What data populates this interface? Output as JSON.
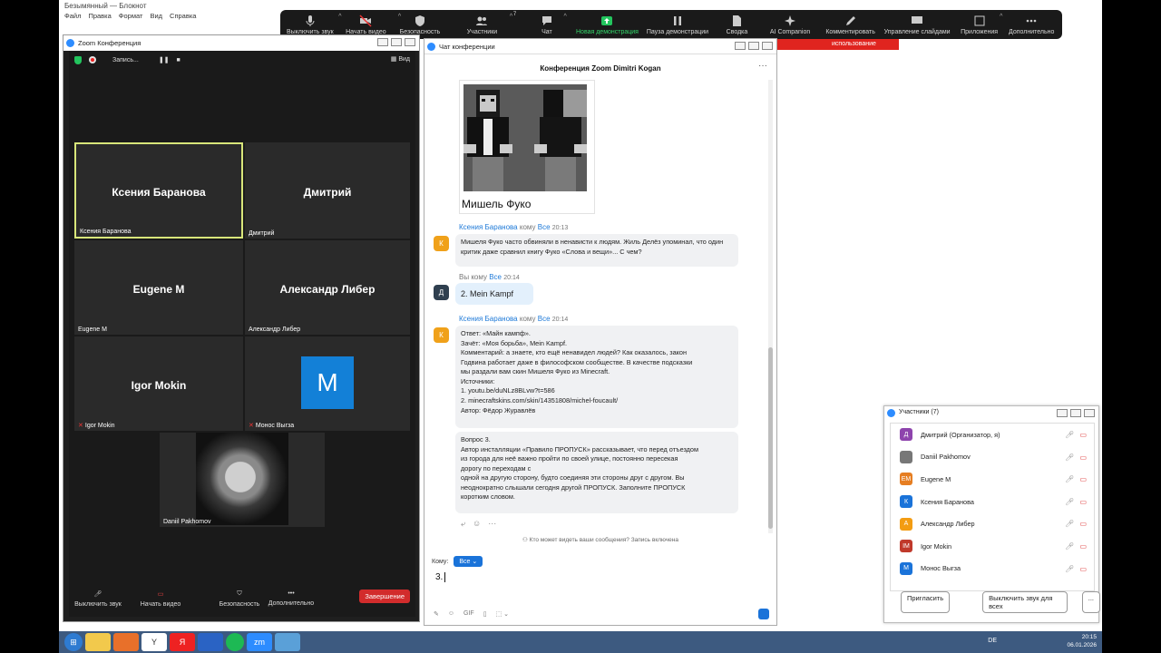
{
  "notepad": {
    "title": "Безымянный — Блокнот",
    "menu": [
      "Файл",
      "Правка",
      "Формат",
      "Вид",
      "Справка"
    ],
    "stop_banner": "использование"
  },
  "toolbar": [
    {
      "label": "Выключить звук",
      "icon": "mic-icon"
    },
    {
      "label": "Начать видео",
      "icon": "video-off-icon"
    },
    {
      "label": "Безопасность",
      "icon": "shield-icon"
    },
    {
      "label": "Участники",
      "icon": "participants-icon",
      "badge": "7"
    },
    {
      "label": "Чат",
      "icon": "chat-icon"
    },
    {
      "label": "Новая демонстрация",
      "icon": "share-icon"
    },
    {
      "label": "Пауза демонстрации",
      "icon": "pause-icon"
    },
    {
      "label": "Сводка",
      "icon": "summary-icon"
    },
    {
      "label": "AI Companion",
      "icon": "sparkle-icon"
    },
    {
      "label": "Комментировать",
      "icon": "pen-icon"
    },
    {
      "label": "Управление слайдами",
      "icon": "slides-icon"
    },
    {
      "label": "Приложения",
      "icon": "apps-icon"
    },
    {
      "label": "Дополнительно",
      "icon": "more-icon"
    }
  ],
  "meeting": {
    "title": "Zoom Конференция",
    "recording": "Запись...",
    "view": "Вид",
    "tiles": [
      {
        "big": "Ксения Баранова",
        "small": "Ксения Баранова"
      },
      {
        "big": "Дмитрий",
        "small": "Дмитрий"
      },
      {
        "big": "Eugene M",
        "small": "Eugene M"
      },
      {
        "big": "Александр Либер",
        "small": "Александр Либер"
      },
      {
        "big": "Igor Mokin",
        "small": "Igor Mokin"
      },
      {
        "big": "M",
        "small": "Монос Выгза"
      },
      {
        "big": "",
        "small": "Daniil Pakhomov"
      }
    ],
    "bottom": {
      "mute": "Выключить звук",
      "video": "Начать видео",
      "security": "Безопасность",
      "more": "Дополнительно",
      "end": "Завершение"
    }
  },
  "chat": {
    "window_title": "Чат конференции",
    "header": "Конференция Zoom Dimitri Kogan",
    "image_caption": "Мишель Фуко",
    "messages": [
      {
        "sender": "Ксения Баранова",
        "to_word": "кому",
        "to": "Все",
        "time": "20:13",
        "avatar": "К",
        "text": "Мишеля Фуко часто обвиняли в ненависти к людям. Жиль Делёз упоминал, что один критик даже сравнил книгу Фуко «Слова и вещи»... С чем?"
      },
      {
        "sender": "Вы",
        "to_word": "кому",
        "to": "Все",
        "time": "20:14",
        "avatar": "Д",
        "text": "2. Mein Kampf"
      },
      {
        "sender": "Ксения Баранова",
        "to_word": "кому",
        "to": "Все",
        "time": "20:14",
        "avatar": "К",
        "lines": [
          "Ответ: «Майн кампф».",
          "Зачёт: «Моя борьба», Mein Kampf.",
          "Комментарий: а знаете, кто ещё ненавидел людей? Как оказалось, закон",
          "Годвина работает даже в философском сообществе. В качестве подсказки",
          "мы раздали вам скин Мишеля Фуко из Minecraft.",
          "Источники:",
          "1. youtu.be/duNLz8BLvw?t=586",
          "2. minecraftskins.com/skin/14351808/michel-foucault/",
          "Автор: Фёдор Журавлёв"
        ],
        "lines2": [
          "Вопрос 3.",
          "Автор инсталляции «Правило ПРОПУСК» рассказывает, что перед отъездом",
          "из города для неё важно пройти по своей улице, постоянно пересекая",
          "дорогу по переходам с",
          "одной на другую сторону, будто соединяя эти стороны друг с другом. Вы",
          "неоднократно слышали сегодня другой ПРОПУСК. Заполните ПРОПУСК",
          "коротким словом."
        ]
      }
    ],
    "notice": "Кто может видеть ваши сообщения? Запись включена",
    "to_label": "Кому:",
    "to_value": "Все",
    "input_value": "3.",
    "tools": [
      "GIF"
    ]
  },
  "participants": {
    "title": "Участники (7)",
    "list": [
      {
        "initials": "Д",
        "name": "Дмитрий (Организатор, я)",
        "color": "#8e44ad"
      },
      {
        "initials": "",
        "name": "Daniil Pakhomov",
        "color": "#777777"
      },
      {
        "initials": "EM",
        "name": "Eugene M",
        "color": "#e67e22"
      },
      {
        "initials": "К",
        "name": "Ксения Баранова",
        "color": "#1a73d9"
      },
      {
        "initials": "А",
        "name": "Александр Либер",
        "color": "#f39c12"
      },
      {
        "initials": "IM",
        "name": "Igor Mokin",
        "color": "#c0392b"
      },
      {
        "initials": "М",
        "name": "Монос Выгза",
        "color": "#1a73d9"
      }
    ],
    "invite": "Пригласить",
    "mute_all": "Выключить звук для всех",
    "more": "..."
  },
  "taskbar": {
    "lang": "DE",
    "time": "20:15",
    "date": "06.01.2026",
    "apps": [
      "start-icon",
      "explorer-icon",
      "firefox-icon",
      "yandex-icon",
      "yandex-browser-icon",
      "save-icon",
      "chrome-icon",
      "zoom-icon",
      "notepad-icon"
    ]
  },
  "colors": {
    "accent": "#1a73d9",
    "zoom_dark": "#1a1a1a",
    "share_green": "#23c55e",
    "end_red": "#d22c2c"
  }
}
